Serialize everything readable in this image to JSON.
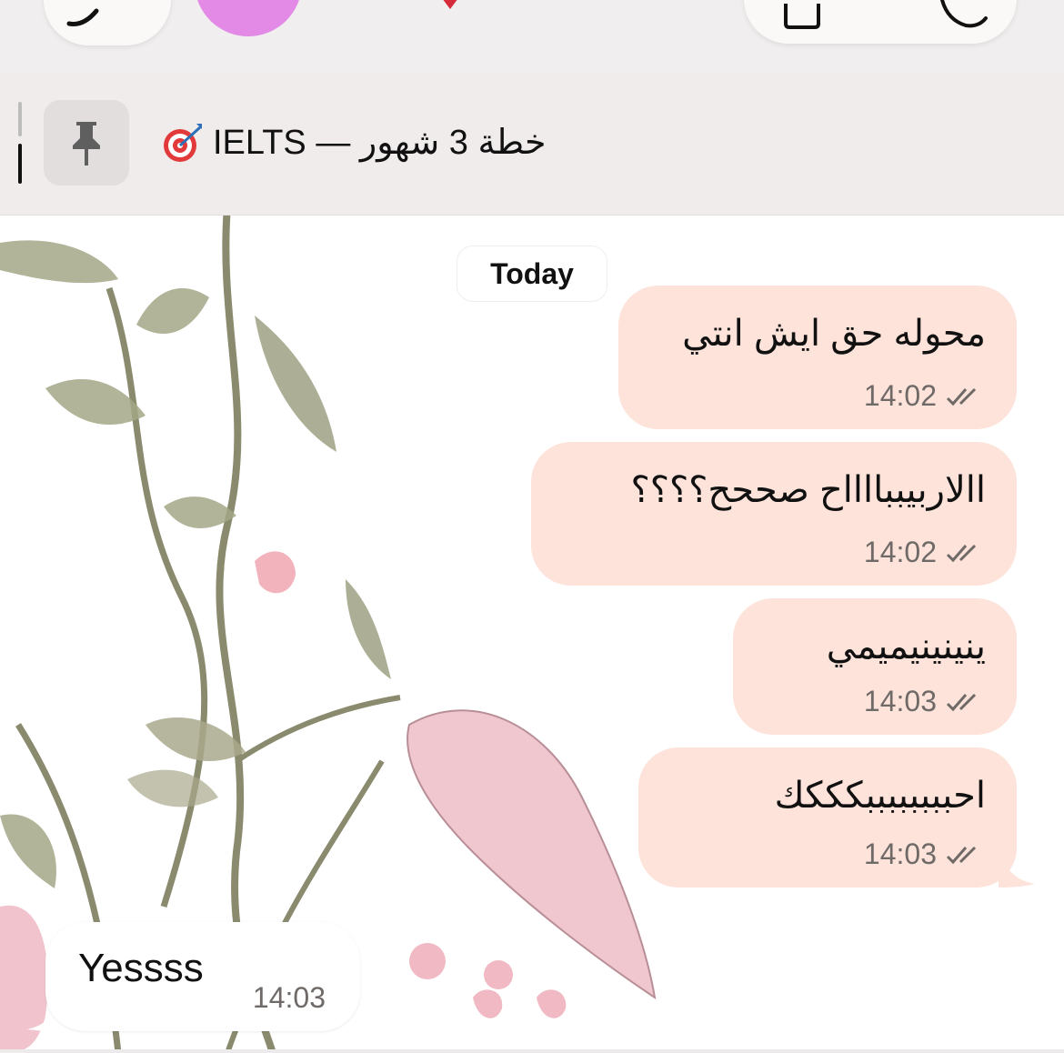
{
  "header": {
    "back_icon": "back-icon",
    "avatar_color": "#e28ae6",
    "status_icon": "heart-icon",
    "call_icons": [
      "video-call-icon",
      "phone-icon"
    ]
  },
  "pinned": {
    "icon": "pin-icon",
    "title": "خطة 3 شهور — IELTS",
    "emoji": "target-icon"
  },
  "chat": {
    "date_chip": "Today",
    "outgoing": [
      {
        "text": "محوله حق ايش انتي",
        "time": "14:02"
      },
      {
        "text": "االاربيببااااح صححح؟؟؟؟",
        "time": "14:02"
      },
      {
        "text": "ينينينيميمي",
        "time": "14:03"
      },
      {
        "text": "احببببببببكككك",
        "time": "14:03"
      }
    ],
    "incoming": [
      {
        "text": "Yessss",
        "time": "14:03"
      }
    ],
    "colors": {
      "outgoing_bubble": "#fde3da",
      "incoming_bubble": "#ffffff"
    }
  }
}
